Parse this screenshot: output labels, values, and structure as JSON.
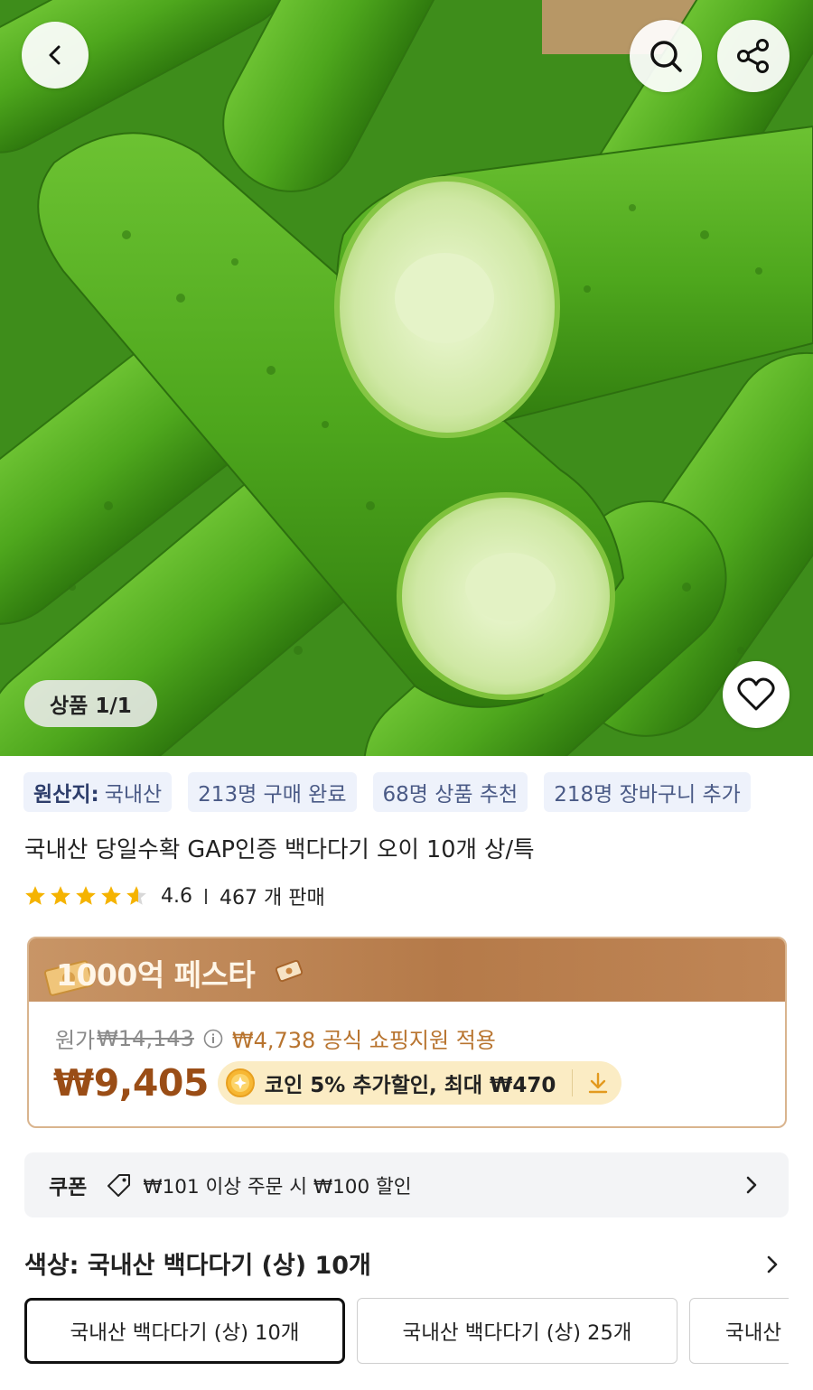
{
  "hero": {
    "image_counter": "상품 1/1",
    "icons": {
      "back": "chevron-left-icon",
      "search": "search-icon",
      "share": "share-icon",
      "like": "heart-icon"
    }
  },
  "stats_chips": {
    "origin_label": "원산지:",
    "origin_value": "국내산",
    "purchased": "213명 구매 완료",
    "recommended": "68명 상품 추천",
    "cart": "218명 장바구니 추가"
  },
  "product": {
    "title": "국내산 당일수확 GAP인증 백다다기 오이 10개 상/특",
    "rating": "4.6",
    "rating_value": 4.6,
    "rating_max": 5,
    "sold": "467 개 판매"
  },
  "festa": {
    "title": "1000억 페스타",
    "original_label": "원가",
    "original_price": "₩14,143",
    "support_text": "₩4,738 공식 쇼핑지원 적용",
    "price": "₩9,405",
    "coin_text": "코인 5% 추가할인, 최대 ₩470"
  },
  "coupon": {
    "label": "쿠폰",
    "text": "₩101 이상 주문 시 ₩100 할인"
  },
  "options": {
    "title": "색상: 국내산 백다다기 (상) 10개",
    "items": [
      "국내산 백다다기 (상) 10개",
      "국내산 백다다기 (상) 25개",
      "국내산"
    ],
    "selected_index": 0
  },
  "colors": {
    "price": "#9a4d16",
    "support": "#b8742f",
    "chip_bg": "#eef2fb",
    "star": "#f5b301"
  }
}
